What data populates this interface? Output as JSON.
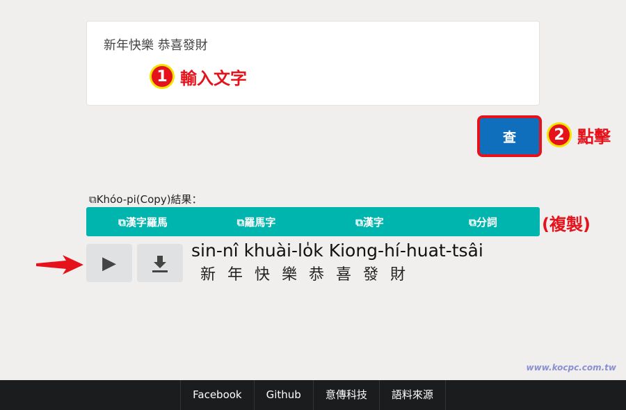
{
  "input": {
    "value": "新年快樂 恭喜發財"
  },
  "annotations": {
    "step1_num": "1",
    "step1_text": "輸入文字",
    "step2_num": "2",
    "step2_text": "點擊",
    "copy_note": "(複製)"
  },
  "query_button": "查",
  "copy": {
    "label": "Khóo-pi(Copy)結果：",
    "buttons": [
      "漢字羅馬",
      "羅馬字",
      "漢字",
      "分詞"
    ]
  },
  "result": {
    "romanization": "sin-nî khuài-lo̍k Kiong-hí-huat-tsâi",
    "hanzi": "新年快樂恭喜發財"
  },
  "icons": {
    "play": "play-icon",
    "download": "download-icon",
    "copy": "copy-icon"
  },
  "footer": [
    "Facebook",
    "Github",
    "意傳科技",
    "語料來源"
  ],
  "watermark": "www.kocpc.com.tw",
  "colors": {
    "accent": "#00b5ad",
    "primary": "#0f6fbc",
    "annotation": "#e5121b"
  }
}
